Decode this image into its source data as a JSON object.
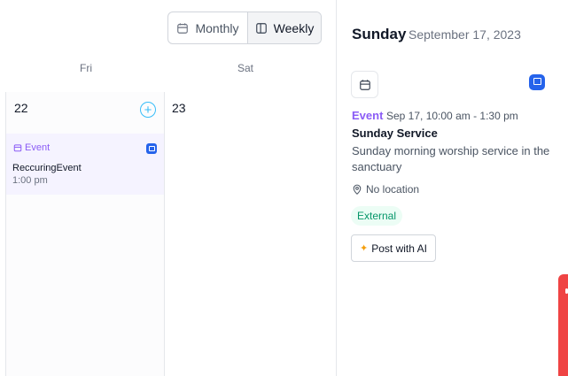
{
  "toggle": {
    "monthly_label": "Monthly",
    "weekly_label": "Weekly",
    "active": "weekly"
  },
  "calendar": {
    "days": [
      {
        "name": "Fri",
        "date": "22"
      },
      {
        "name": "Sat",
        "date": "23"
      }
    ],
    "add_symbol": "+",
    "event": {
      "type_label": "Event",
      "title": "ReccuringEvent",
      "time": "1:00 pm"
    }
  },
  "panel": {
    "day": "Sunday",
    "date": "September 17, 2023",
    "event": {
      "type_label": "Event",
      "when": "Sep 17, 10:00 am - 1:30 pm",
      "title": "Sunday Service",
      "description": "Sunday morning worship service in the sanctuary",
      "location": "No location",
      "badge": "External",
      "ai_button": "Post with AI"
    }
  },
  "colors": {
    "accent_purple": "#8b5cf6",
    "accent_blue": "#2563eb",
    "badge_green": "#059669",
    "add_cyan": "#38bdf8",
    "alert_red": "#ef4444"
  },
  "icons": {
    "monthly": "calendar-icon",
    "weekly": "columns-icon",
    "event": "calendar-icon",
    "chat": "chat-icon",
    "location": "map-pin-icon",
    "ai": "sparkles-icon"
  }
}
